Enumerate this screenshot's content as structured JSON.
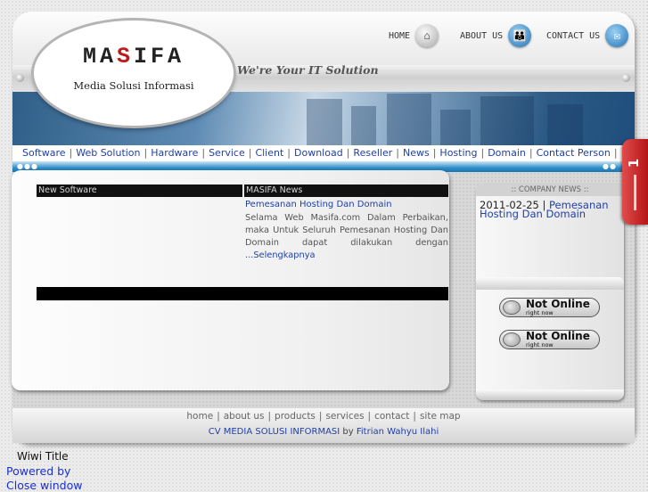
{
  "header": {
    "logo_word": [
      "MA",
      "S",
      "IFA"
    ],
    "logo_subtitle": "Media Solusi Informasi",
    "tagline": "We're Your IT Solution",
    "nav": [
      {
        "label": "HOME",
        "icon": "home-icon"
      },
      {
        "label": "ABOUT US",
        "icon": "people-icon"
      },
      {
        "label": "CONTACT US",
        "icon": "mail-icon"
      }
    ]
  },
  "menu": [
    "Software",
    "Web Solution",
    "Hardware",
    "Service",
    "Client",
    "Download",
    "Reseller",
    "News",
    "Hosting",
    "Domain",
    "Contact Person"
  ],
  "main": {
    "new_software_title": "New Software",
    "news_title": "MASIFA News",
    "news_link": "Pemesanan Hosting Dan Domain",
    "news_body": "Selama Web Masifa.com Dalam Perbaikan, maka Untuk Seluruh Pemesanan Hosting Dan Domain dapat dilakukan dengan",
    "news_more": "...Selengkapnya"
  },
  "company_news": {
    "title": ":: COMPANY NEWS ::",
    "date": "2011-02-25",
    "link": "Pemesanan Hosting Dan Domain",
    "status": [
      {
        "main": "Not Online",
        "sub": "right now"
      },
      {
        "main": "Not Online",
        "sub": "right now"
      }
    ]
  },
  "footer": {
    "links": [
      "home",
      "about us",
      "products",
      "services",
      "contact",
      "site map"
    ],
    "company": "CV MEDIA SOLUSI INFORMASI",
    "by": "by",
    "author": "Fitrian Wahyu Ilahi"
  },
  "side_tab": {
    "number": "1"
  },
  "bottom": {
    "title": "Wiwi Title",
    "powered": "Powered by",
    "close": "Close window"
  },
  "colors": {
    "accent_blue": "#1f3fa8",
    "logo_red": "#c0181c",
    "menu_line": "#2e8fca"
  }
}
